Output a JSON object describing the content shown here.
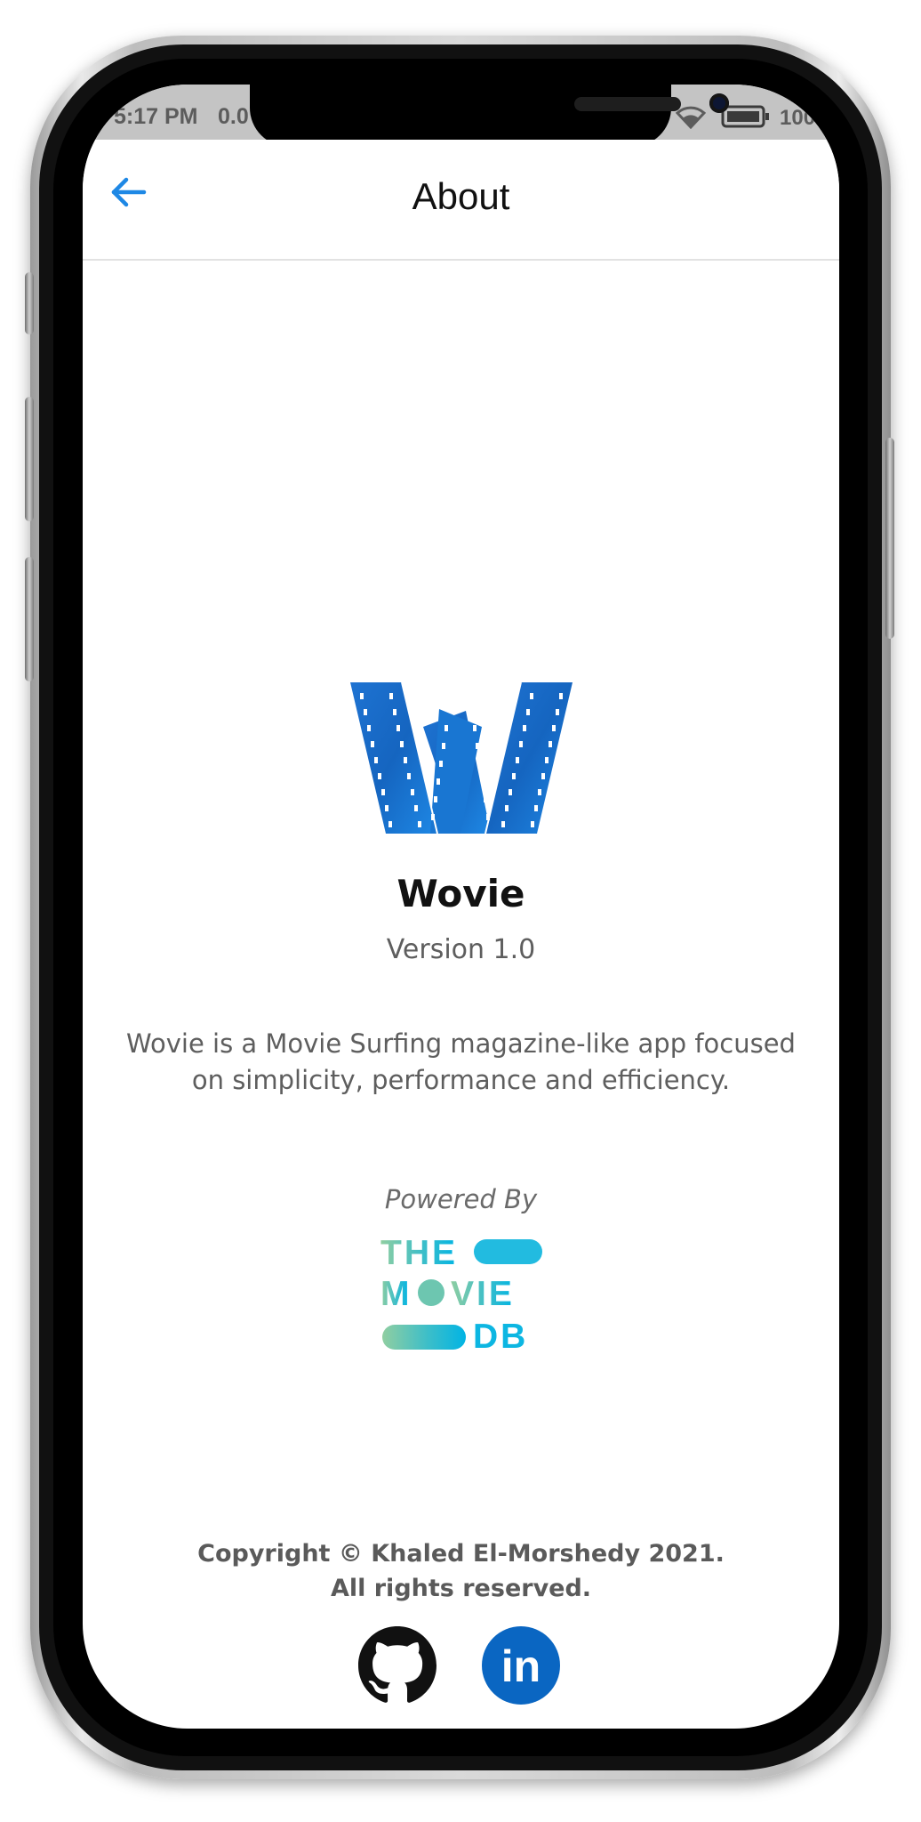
{
  "status_bar": {
    "time": "5:17 PM",
    "network": "0.0",
    "battery": "100"
  },
  "app_bar": {
    "title": "About",
    "back_icon": "arrow-left-icon"
  },
  "about": {
    "logo_icon": "wovie-logo",
    "app_name": "Wovie",
    "version": "Version 1.0",
    "description": "Wovie is a Movie Surfing magazine-like app focused on simplicity, performance and efficiency.",
    "powered_by": "Powered By",
    "tmdb": {
      "line1": "THE",
      "line2_a": "M",
      "line2_b": "VIE",
      "line3": "DB"
    },
    "copyright_line1": "Copyright © Khaled El-Morshedy 2021.",
    "copyright_line2": "All rights reserved."
  },
  "social": {
    "github_icon": "github-icon",
    "linkedin_icon": "linkedin-icon",
    "linkedin_text": "in"
  },
  "colors": {
    "accent": "#1e88e5",
    "logo_blue": "#1565c0",
    "tmdb_green": "#90cea1",
    "tmdb_blue": "#01b4e4",
    "linkedin": "#0a66c2"
  }
}
